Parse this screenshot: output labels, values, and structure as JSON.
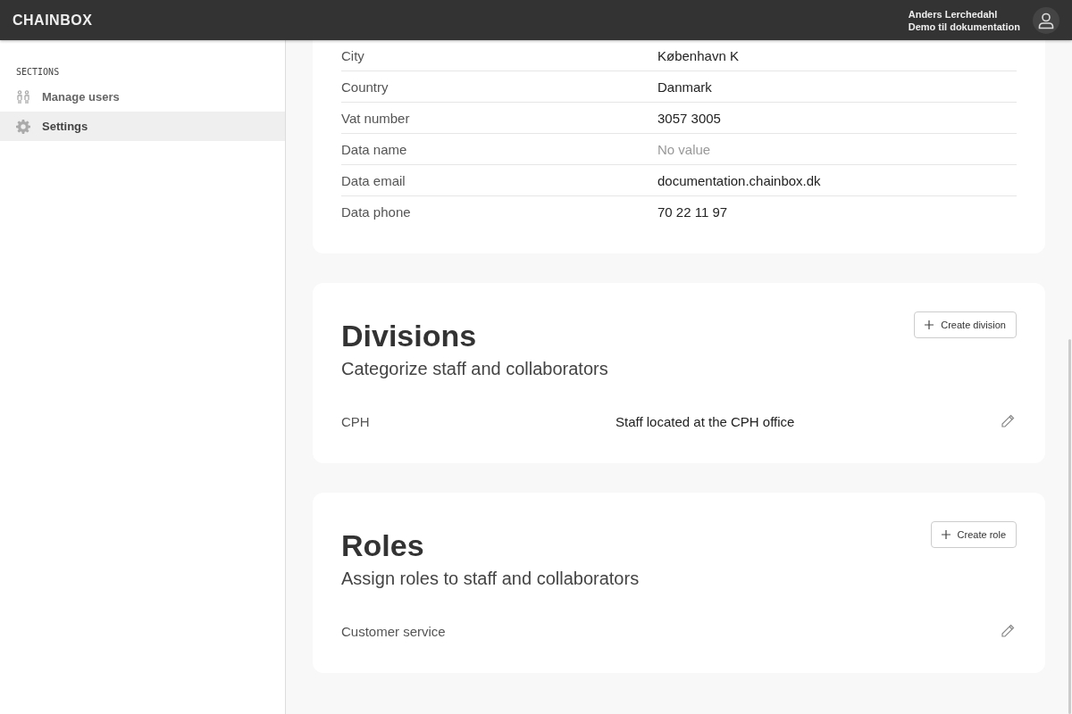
{
  "header": {
    "logo": "CHAINBOX",
    "user_name": "Anders Lerchedahl",
    "organization": "Demo til dokumentation"
  },
  "sidebar": {
    "heading": "SECTIONS",
    "items": [
      {
        "label": "Manage users",
        "kind": "users",
        "selected": false
      },
      {
        "label": "Settings",
        "kind": "gear",
        "selected": true
      }
    ]
  },
  "details": {
    "rows": [
      {
        "label": "City",
        "value": "København K",
        "empty": false
      },
      {
        "label": "Country",
        "value": "Danmark",
        "empty": false
      },
      {
        "label": "Vat number",
        "value": "3057 3005",
        "empty": false
      },
      {
        "label": "Data name",
        "value": "No value",
        "empty": true
      },
      {
        "label": "Data email",
        "value": "documentation.chainbox.dk",
        "empty": false
      },
      {
        "label": "Data phone",
        "value": "70 22 11 97",
        "empty": false
      }
    ]
  },
  "sections": [
    {
      "title": "Divisions",
      "subtitle": "Categorize staff and collaborators",
      "button": "Create division",
      "items": [
        {
          "name": "CPH",
          "description": "Staff located at the CPH office"
        }
      ]
    },
    {
      "title": "Roles",
      "subtitle": "Assign roles to staff and collaborators",
      "button": "Create role",
      "items": [
        {
          "name": "Customer service"
        }
      ]
    }
  ]
}
